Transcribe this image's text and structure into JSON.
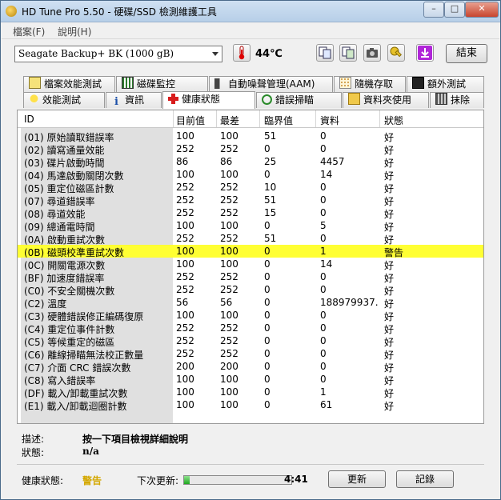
{
  "window": {
    "title": "HD Tune Pro 5.50 - 硬碟/SSD 檢測維護工具"
  },
  "menu": [
    "檔案(F)",
    "說明(H)"
  ],
  "toolbar": {
    "drive": "Seagate Backup+ BK (1000 gB)",
    "temperature": "44℃",
    "exit_label": "結束"
  },
  "tabs_top": [
    {
      "label": "檔案效能測試",
      "icon": "file-benchmark-icon"
    },
    {
      "label": "磁碟監控",
      "icon": "disk-monitor-icon"
    },
    {
      "label": "自動噪聲管理(AAM)",
      "icon": "speaker-icon"
    },
    {
      "label": "隨機存取",
      "icon": "random-access-icon"
    },
    {
      "label": "額外測試",
      "icon": "extra-tests-icon"
    }
  ],
  "tabs_bottom": [
    {
      "label": "效能測試",
      "icon": "lightbulb-icon"
    },
    {
      "label": "資訊",
      "icon": "info-icon"
    },
    {
      "label": "健康狀態",
      "icon": "health-cross-icon",
      "active": true
    },
    {
      "label": "錯誤掃瞄",
      "icon": "magnifier-icon"
    },
    {
      "label": "資料夾使用",
      "icon": "folder-icon"
    },
    {
      "label": "抹除",
      "icon": "trash-icon"
    }
  ],
  "table": {
    "headers": [
      "ID",
      "目前值",
      "最差",
      "臨界值",
      "資料",
      "狀態"
    ],
    "rows": [
      [
        "(01) 原始讀取錯誤率",
        "100",
        "100",
        "51",
        "0",
        "好"
      ],
      [
        "(02) 讀寫通量效能",
        "252",
        "252",
        "0",
        "0",
        "好"
      ],
      [
        "(03) 碟片啟動時間",
        "86",
        "86",
        "25",
        "4457",
        "好"
      ],
      [
        "(04) 馬達啟動關閉次數",
        "100",
        "100",
        "0",
        "14",
        "好"
      ],
      [
        "(05) 重定位磁區計數",
        "252",
        "252",
        "10",
        "0",
        "好"
      ],
      [
        "(07) 尋道錯誤率",
        "252",
        "252",
        "51",
        "0",
        "好"
      ],
      [
        "(08) 尋道效能",
        "252",
        "252",
        "15",
        "0",
        "好"
      ],
      [
        "(09) 總通電時間",
        "100",
        "100",
        "0",
        "5",
        "好"
      ],
      [
        "(0A) 啟動重試次數",
        "252",
        "252",
        "51",
        "0",
        "好"
      ],
      [
        "(0B) 磁頭校準重試次數",
        "100",
        "100",
        "0",
        "1",
        "警告"
      ],
      [
        "(0C) 開關電源次數",
        "100",
        "100",
        "0",
        "14",
        "好"
      ],
      [
        "(BF) 加速度錯誤率",
        "252",
        "252",
        "0",
        "0",
        "好"
      ],
      [
        "(C0) 不安全關機次數",
        "252",
        "252",
        "0",
        "0",
        "好"
      ],
      [
        "(C2) 溫度",
        "56",
        "56",
        "0",
        "188979937...",
        "好"
      ],
      [
        "(C3) 硬體錯誤修正編碼復原",
        "100",
        "100",
        "0",
        "0",
        "好"
      ],
      [
        "(C4) 重定位事件計數",
        "252",
        "252",
        "0",
        "0",
        "好"
      ],
      [
        "(C5) 等候重定的磁區",
        "252",
        "252",
        "0",
        "0",
        "好"
      ],
      [
        "(C6) 離線掃瞄無法校正數量",
        "252",
        "252",
        "0",
        "0",
        "好"
      ],
      [
        "(C7) 介面 CRC 錯誤次數",
        "200",
        "200",
        "0",
        "0",
        "好"
      ],
      [
        "(C8) 寫入錯誤率",
        "100",
        "100",
        "0",
        "0",
        "好"
      ],
      [
        "(DF) 載入/卸載重試次數",
        "100",
        "100",
        "0",
        "1",
        "好"
      ],
      [
        "(E1) 載入/卸載迴圈計數",
        "100",
        "100",
        "0",
        "61",
        "好"
      ]
    ],
    "warn_row_index": 9
  },
  "details": {
    "desc_label": "描述:",
    "desc_value": "按一下項目檢視詳細說明",
    "status_label": "狀態:",
    "status_value": "n/a"
  },
  "status": {
    "health_label": "健康狀態:",
    "health_value": "警告",
    "next_update_label": "下次更新:",
    "next_update_time": "4:41",
    "progress_fraction": 0.05,
    "refresh_label": "更新",
    "log_label": "記錄"
  },
  "colors": {
    "warn_row": "#ffff33",
    "warn_text": "#d4a800",
    "progress": "#1fa81f"
  }
}
